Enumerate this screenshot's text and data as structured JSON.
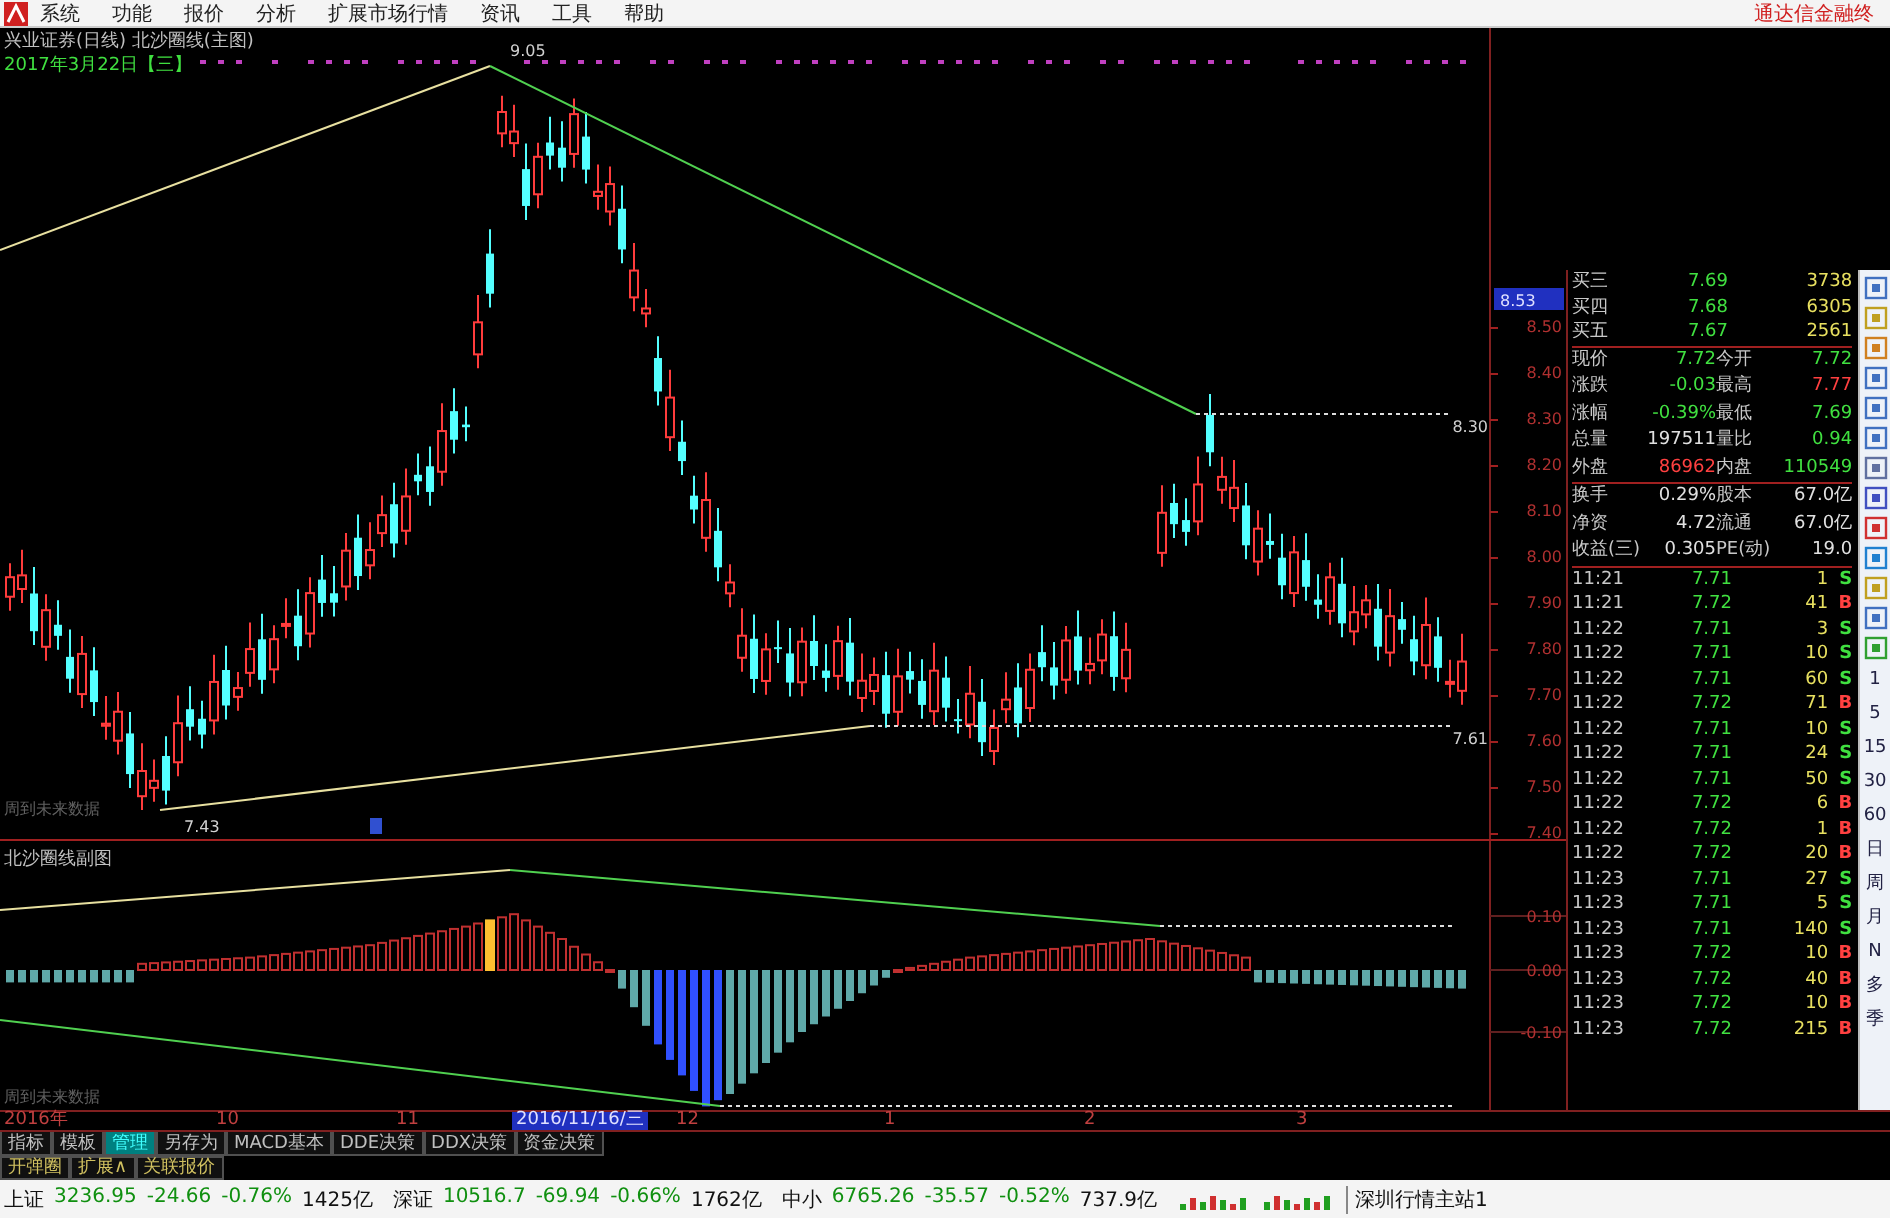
{
  "menu": {
    "items": [
      "系统",
      "功能",
      "报价",
      "分析",
      "扩展市场行情",
      "资讯",
      "工具",
      "帮助"
    ],
    "title": "通达信金融终"
  },
  "chart": {
    "title": "兴业证券(日线) 北沙圈线(主图)",
    "date": "2017年3月22日【三】",
    "future_note": "周到未来数据",
    "current_price": "8.53",
    "price_ticks": [
      "8.50",
      "8.40",
      "8.30",
      "8.20",
      "8.10",
      "8.00",
      "7.90",
      "7.80",
      "7.70",
      "7.60",
      "7.50",
      "7.40"
    ],
    "annotations": [
      {
        "text": "9.05"
      },
      {
        "text": "7.43"
      },
      {
        "text": "8.30"
      },
      {
        "text": "7.61"
      }
    ]
  },
  "indicator": {
    "title": "北沙圈线副图",
    "future_note": "周到未来数据",
    "ticks": [
      "0.10",
      "0.00",
      "-0.10"
    ]
  },
  "date_axis": [
    {
      "text": "2016年",
      "kind": "month"
    },
    {
      "text": "10",
      "kind": "month"
    },
    {
      "text": "11",
      "kind": "month"
    },
    {
      "text": "2016/11/16/三",
      "kind": "cursor"
    },
    {
      "text": "12",
      "kind": "month"
    },
    {
      "text": "1",
      "kind": "month"
    },
    {
      "text": "2",
      "kind": "month"
    },
    {
      "text": "3",
      "kind": "month"
    }
  ],
  "tabs": [
    {
      "label": "指标",
      "selected": false
    },
    {
      "label": "模板",
      "selected": false
    },
    {
      "label": "管理",
      "selected": true
    },
    {
      "label": "另存为",
      "selected": false
    },
    {
      "label": "MACD基本",
      "selected": false
    },
    {
      "label": "DDE决策",
      "selected": false
    },
    {
      "label": "DDX决策",
      "selected": false
    },
    {
      "label": "资金决策",
      "selected": false
    }
  ],
  "tabs_row2": [
    "开弹圈",
    "扩展∧",
    "关联报价"
  ],
  "quote": {
    "bids": [
      {
        "label": "买三",
        "price": {
          "text": "7.69",
          "color": "#40e040"
        },
        "volume": "3738"
      },
      {
        "label": "买四",
        "price": {
          "text": "7.68",
          "color": "#40e040"
        },
        "volume": "6305"
      },
      {
        "label": "买五",
        "price": {
          "text": "7.67",
          "color": "#40e040"
        },
        "volume": "2561"
      }
    ],
    "stats": [
      {
        "label": "现价",
        "value": {
          "text": "7.72",
          "color": "#40e040"
        },
        "label2": "今开",
        "value2": {
          "text": "7.72",
          "color": "#40e040"
        }
      },
      {
        "label": "涨跌",
        "value": {
          "text": "-0.03",
          "color": "#40e040"
        },
        "label2": "最高",
        "value2": {
          "text": "7.77",
          "color": "#ff4040"
        }
      },
      {
        "label": "涨幅",
        "value": {
          "text": "-0.39%",
          "color": "#40e040"
        },
        "label2": "最低",
        "value2": {
          "text": "7.69",
          "color": "#40e040"
        }
      },
      {
        "label": "总量",
        "value": {
          "text": "197511",
          "color": "#e0e0e0"
        },
        "label2": "量比",
        "value2": {
          "text": "0.94",
          "color": "#40e040"
        }
      },
      {
        "label": "外盘",
        "value": {
          "text": "86962",
          "color": "#ff4040"
        },
        "label2": "内盘",
        "value2": {
          "text": "110549",
          "color": "#40e040"
        }
      }
    ],
    "fundamentals": [
      {
        "label": "换手",
        "value": {
          "text": "0.29%",
          "color": "#e0e0e0"
        },
        "label2": "股本",
        "value2": {
          "text": "67.0亿",
          "color": "#e0e0e0"
        }
      },
      {
        "label": "净资",
        "value": {
          "text": "4.72",
          "color": "#e0e0e0"
        },
        "label2": "流通",
        "value2": {
          "text": "67.0亿",
          "color": "#e0e0e0"
        }
      },
      {
        "label": "收益(三)",
        "value": {
          "text": "0.305",
          "color": "#e0e0e0"
        },
        "label2": "PE(动)",
        "value2": {
          "text": "19.0",
          "color": "#e0e0e0"
        }
      }
    ]
  },
  "ticks": [
    {
      "time": "11:21",
      "price": "7.71",
      "volume": "1",
      "side": "S",
      "kind": "sell"
    },
    {
      "time": "11:21",
      "price": "7.72",
      "volume": "41",
      "side": "B",
      "kind": "buy"
    },
    {
      "time": "11:22",
      "price": "7.71",
      "volume": "3",
      "side": "S",
      "kind": "sell"
    },
    {
      "time": "11:22",
      "price": "7.71",
      "volume": "10",
      "side": "S",
      "kind": "sell"
    },
    {
      "time": "11:22",
      "price": "7.71",
      "volume": "60",
      "side": "S",
      "kind": "sell"
    },
    {
      "time": "11:22",
      "price": "7.72",
      "volume": "71",
      "side": "B",
      "kind": "buy"
    },
    {
      "time": "11:22",
      "price": "7.71",
      "volume": "10",
      "side": "S",
      "kind": "sell"
    },
    {
      "time": "11:22",
      "price": "7.71",
      "volume": "24",
      "side": "S",
      "kind": "sell"
    },
    {
      "time": "11:22",
      "price": "7.71",
      "volume": "50",
      "side": "S",
      "kind": "sell"
    },
    {
      "time": "11:22",
      "price": "7.72",
      "volume": "6",
      "side": "B",
      "kind": "buy"
    },
    {
      "time": "11:22",
      "price": "7.72",
      "volume": "1",
      "side": "B",
      "kind": "buy"
    },
    {
      "time": "11:22",
      "price": "7.72",
      "volume": "20",
      "side": "B",
      "kind": "buy"
    },
    {
      "time": "11:23",
      "price": "7.71",
      "volume": "27",
      "side": "S",
      "kind": "sell"
    },
    {
      "time": "11:23",
      "price": "7.71",
      "volume": "5",
      "side": "S",
      "kind": "sell"
    },
    {
      "time": "11:23",
      "price": "7.71",
      "volume": "140",
      "side": "S",
      "kind": "sell"
    },
    {
      "time": "11:23",
      "price": "7.72",
      "volume": "10",
      "side": "B",
      "kind": "buy"
    },
    {
      "time": "11:23",
      "price": "7.72",
      "volume": "40",
      "side": "B",
      "kind": "buy"
    },
    {
      "time": "11:23",
      "price": "7.72",
      "volume": "10",
      "side": "B",
      "kind": "buy"
    },
    {
      "time": "11:23",
      "price": "7.72",
      "volume": "215",
      "side": "B",
      "kind": "buy"
    }
  ],
  "side_toolbar": {
    "periods": [
      "1",
      "5",
      "15",
      "30",
      "60",
      "日",
      "周",
      "月",
      "N",
      "多",
      "季"
    ]
  },
  "status_bar": {
    "indices": [
      {
        "name": "上证",
        "value": "3236.95",
        "change": "-24.66",
        "percent": "-0.76%",
        "amount": "1425亿"
      },
      {
        "name": "深证",
        "value": "10516.7",
        "change": "-69.94",
        "percent": "-0.66%",
        "amount": "1762亿"
      },
      {
        "name": "中小",
        "value": "6765.26",
        "change": "-35.57",
        "percent": "-0.52%",
        "amount": "737.9亿"
      }
    ],
    "feed": "深圳行情主站1"
  }
}
